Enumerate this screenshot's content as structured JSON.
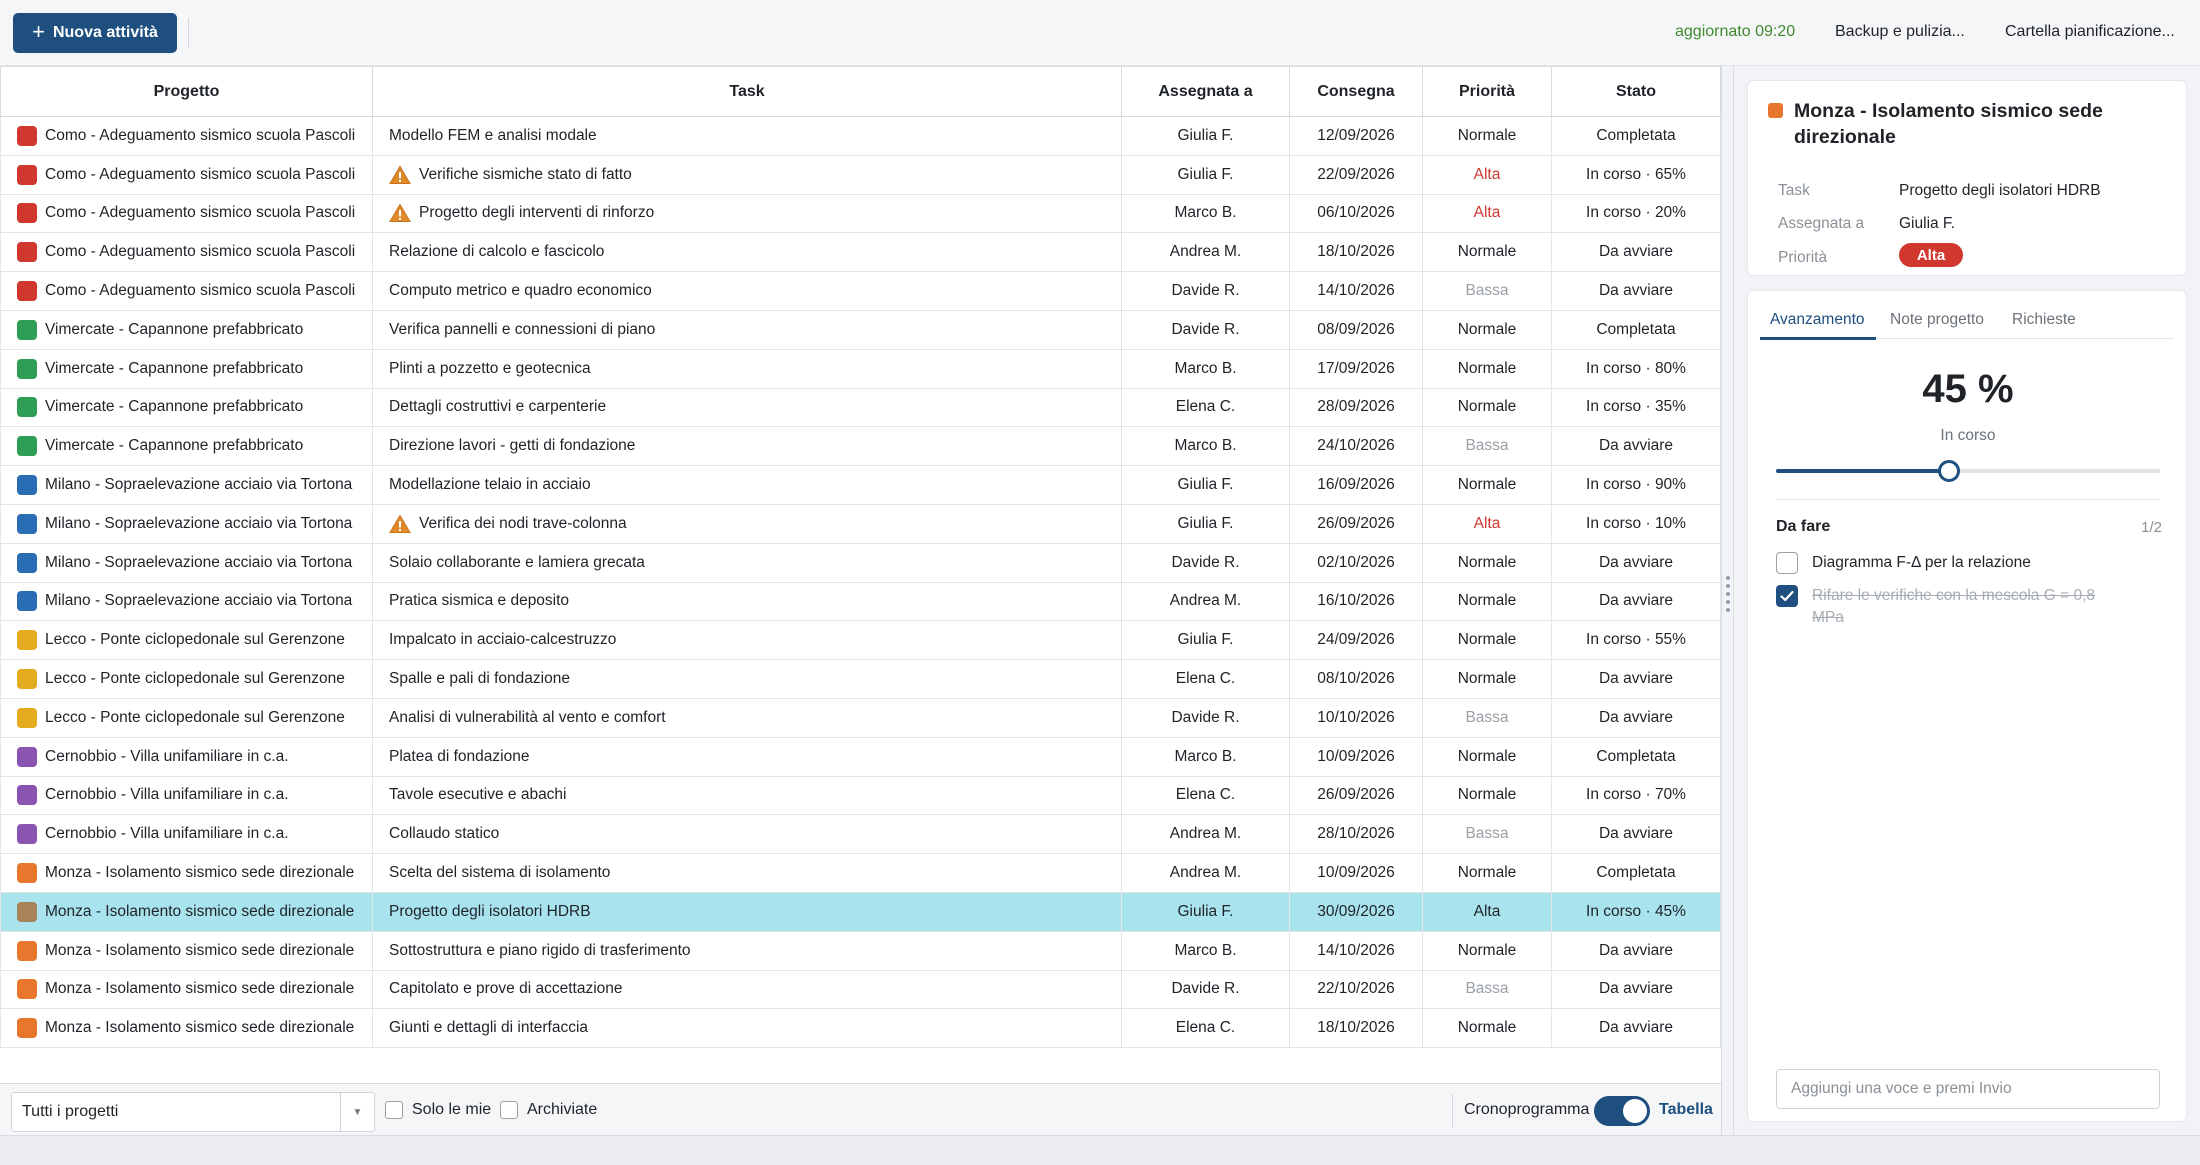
{
  "toolbar": {
    "new_button": "Nuova attività",
    "updated": "aggiornato 09:20",
    "backup": "Backup e pulizia...",
    "folder": "Cartella pianificazione..."
  },
  "colors": {
    "accent": "#1e4f7f",
    "alta": "#d0382f",
    "selected_row": "#a9e3ee",
    "updated_text": "#3f8a2e"
  },
  "table": {
    "headers": [
      "Progetto",
      "Task",
      "Assegnata a",
      "Consegna",
      "Priorità",
      "Stato"
    ],
    "rows": [
      {
        "color": "#d0382f",
        "project": "Como - Adeguamento sismico scuola Pascoli",
        "task": "Modello FEM e analisi modale",
        "warn": false,
        "assignee": "Giulia F.",
        "due": "12/09/2026",
        "priority": "Normale",
        "status": "Completata"
      },
      {
        "color": "#d0382f",
        "project": "Como - Adeguamento sismico scuola Pascoli",
        "task": "Verifiche sismiche stato di fatto",
        "warn": true,
        "assignee": "Giulia F.",
        "due": "22/09/2026",
        "priority": "Alta",
        "status": "In corso · 65%"
      },
      {
        "color": "#d0382f",
        "project": "Como - Adeguamento sismico scuola Pascoli",
        "task": "Progetto degli interventi di rinforzo",
        "warn": true,
        "assignee": "Marco B.",
        "due": "06/10/2026",
        "priority": "Alta",
        "status": "In corso · 20%"
      },
      {
        "color": "#d0382f",
        "project": "Como - Adeguamento sismico scuola Pascoli",
        "task": "Relazione di calcolo e fascicolo",
        "warn": false,
        "assignee": "Andrea M.",
        "due": "18/10/2026",
        "priority": "Normale",
        "status": "Da avviare"
      },
      {
        "color": "#d0382f",
        "project": "Como - Adeguamento sismico scuola Pascoli",
        "task": "Computo metrico e quadro economico",
        "warn": false,
        "assignee": "Davide R.",
        "due": "14/10/2026",
        "priority": "Bassa",
        "status": "Da avviare"
      },
      {
        "color": "#2e9e57",
        "project": "Vimercate - Capannone prefabbricato",
        "task": "Verifica pannelli e connessioni di piano",
        "warn": false,
        "assignee": "Davide R.",
        "due": "08/09/2026",
        "priority": "Normale",
        "status": "Completata"
      },
      {
        "color": "#2e9e57",
        "project": "Vimercate - Capannone prefabbricato",
        "task": "Plinti a pozzetto e geotecnica",
        "warn": false,
        "assignee": "Marco B.",
        "due": "17/09/2026",
        "priority": "Normale",
        "status": "In corso · 80%"
      },
      {
        "color": "#2e9e57",
        "project": "Vimercate - Capannone prefabbricato",
        "task": "Dettagli costruttivi e carpenterie",
        "warn": false,
        "assignee": "Elena C.",
        "due": "28/09/2026",
        "priority": "Normale",
        "status": "In corso · 35%"
      },
      {
        "color": "#2e9e57",
        "project": "Vimercate - Capannone prefabbricato",
        "task": "Direzione lavori - getti di fondazione",
        "warn": false,
        "assignee": "Marco B.",
        "due": "24/10/2026",
        "priority": "Bassa",
        "status": "Da avviare"
      },
      {
        "color": "#2a6db5",
        "project": "Milano - Sopraelevazione acciaio via Tortona",
        "task": "Modellazione telaio in acciaio",
        "warn": false,
        "assignee": "Giulia F.",
        "due": "16/09/2026",
        "priority": "Normale",
        "status": "In corso · 90%"
      },
      {
        "color": "#2a6db5",
        "project": "Milano - Sopraelevazione acciaio via Tortona",
        "task": "Verifica dei nodi trave-colonna",
        "warn": true,
        "assignee": "Giulia F.",
        "due": "26/09/2026",
        "priority": "Alta",
        "status": "In corso · 10%"
      },
      {
        "color": "#2a6db5",
        "project": "Milano - Sopraelevazione acciaio via Tortona",
        "task": "Solaio collaborante e lamiera grecata",
        "warn": false,
        "assignee": "Davide R.",
        "due": "02/10/2026",
        "priority": "Normale",
        "status": "Da avviare"
      },
      {
        "color": "#2a6db5",
        "project": "Milano - Sopraelevazione acciaio via Tortona",
        "task": "Pratica sismica e deposito",
        "warn": false,
        "assignee": "Andrea M.",
        "due": "16/10/2026",
        "priority": "Normale",
        "status": "Da avviare"
      },
      {
        "color": "#e3ab1f",
        "project": "Lecco - Ponte ciclopedonale sul Gerenzone",
        "task": "Impalcato in acciaio-calcestruzzo",
        "warn": false,
        "assignee": "Giulia F.",
        "due": "24/09/2026",
        "priority": "Normale",
        "status": "In corso · 55%"
      },
      {
        "color": "#e3ab1f",
        "project": "Lecco - Ponte ciclopedonale sul Gerenzone",
        "task": "Spalle e pali di fondazione",
        "warn": false,
        "assignee": "Elena C.",
        "due": "08/10/2026",
        "priority": "Normale",
        "status": "Da avviare"
      },
      {
        "color": "#e3ab1f",
        "project": "Lecco - Ponte ciclopedonale sul Gerenzone",
        "task": "Analisi di vulnerabilità al vento e comfort",
        "warn": false,
        "assignee": "Davide R.",
        "due": "10/10/2026",
        "priority": "Bassa",
        "status": "Da avviare"
      },
      {
        "color": "#8a55b0",
        "project": "Cernobbio - Villa unifamiliare in c.a.",
        "task": "Platea di fondazione",
        "warn": false,
        "assignee": "Marco B.",
        "due": "10/09/2026",
        "priority": "Normale",
        "status": "Completata"
      },
      {
        "color": "#8a55b0",
        "project": "Cernobbio - Villa unifamiliare in c.a.",
        "task": "Tavole esecutive e abachi",
        "warn": false,
        "assignee": "Elena C.",
        "due": "26/09/2026",
        "priority": "Normale",
        "status": "In corso · 70%"
      },
      {
        "color": "#8a55b0",
        "project": "Cernobbio - Villa unifamiliare in c.a.",
        "task": "Collaudo statico",
        "warn": false,
        "assignee": "Andrea M.",
        "due": "28/10/2026",
        "priority": "Bassa",
        "status": "Da avviare"
      },
      {
        "color": "#e8772e",
        "project": "Monza - Isolamento sismico sede direzionale",
        "task": "Scelta del sistema di isolamento",
        "warn": false,
        "assignee": "Andrea M.",
        "due": "10/09/2026",
        "priority": "Normale",
        "status": "Completata"
      },
      {
        "color": "#a9825a",
        "project": "Monza - Isolamento sismico sede direzionale",
        "task": "Progetto degli isolatori HDRB",
        "warn": false,
        "assignee": "Giulia F.",
        "due": "30/09/2026",
        "priority": "Alta",
        "status": "In corso · 45%",
        "selected": true
      },
      {
        "color": "#e8772e",
        "project": "Monza - Isolamento sismico sede direzionale",
        "task": "Sottostruttura e piano rigido di trasferimento",
        "warn": false,
        "assignee": "Marco B.",
        "due": "14/10/2026",
        "priority": "Normale",
        "status": "Da avviare"
      },
      {
        "color": "#e8772e",
        "project": "Monza - Isolamento sismico sede direzionale",
        "task": "Capitolato e prove di accettazione",
        "warn": false,
        "assignee": "Davide R.",
        "due": "22/10/2026",
        "priority": "Bassa",
        "status": "Da avviare"
      },
      {
        "color": "#e8772e",
        "project": "Monza - Isolamento sismico sede direzionale",
        "task": "Giunti e dettagli di interfaccia",
        "warn": false,
        "assignee": "Elena C.",
        "due": "18/10/2026",
        "priority": "Normale",
        "status": "Da avviare"
      }
    ]
  },
  "filters": {
    "project_select": "Tutti i progetti",
    "only_mine": "Solo le mie",
    "archived": "Archiviate",
    "crono": "Cronoprogramma",
    "table_view": "Tabella"
  },
  "detail": {
    "title": "Monza - Isolamento sismico sede direzionale",
    "task_label": "Task",
    "task_value": "Progetto degli isolatori HDRB",
    "assignee_label": "Assegnata a",
    "assignee_value": "Giulia F.",
    "priority_label": "Priorità",
    "priority_value": "Alta",
    "tabs": [
      "Avanzamento",
      "Note progetto",
      "Richieste"
    ],
    "progress_text": "45 %",
    "progress_fraction": 0.45,
    "progress_status": "In corso",
    "todo_title": "Da fare",
    "todo_count": "1/2",
    "todos": [
      {
        "text": "Diagramma F-Δ per la relazione",
        "done": false
      },
      {
        "text": "Rifare le verifiche con la mescola G = 0,8 MPa",
        "done": true
      }
    ],
    "add_placeholder": "Aggiungi una voce e premi Invio"
  }
}
